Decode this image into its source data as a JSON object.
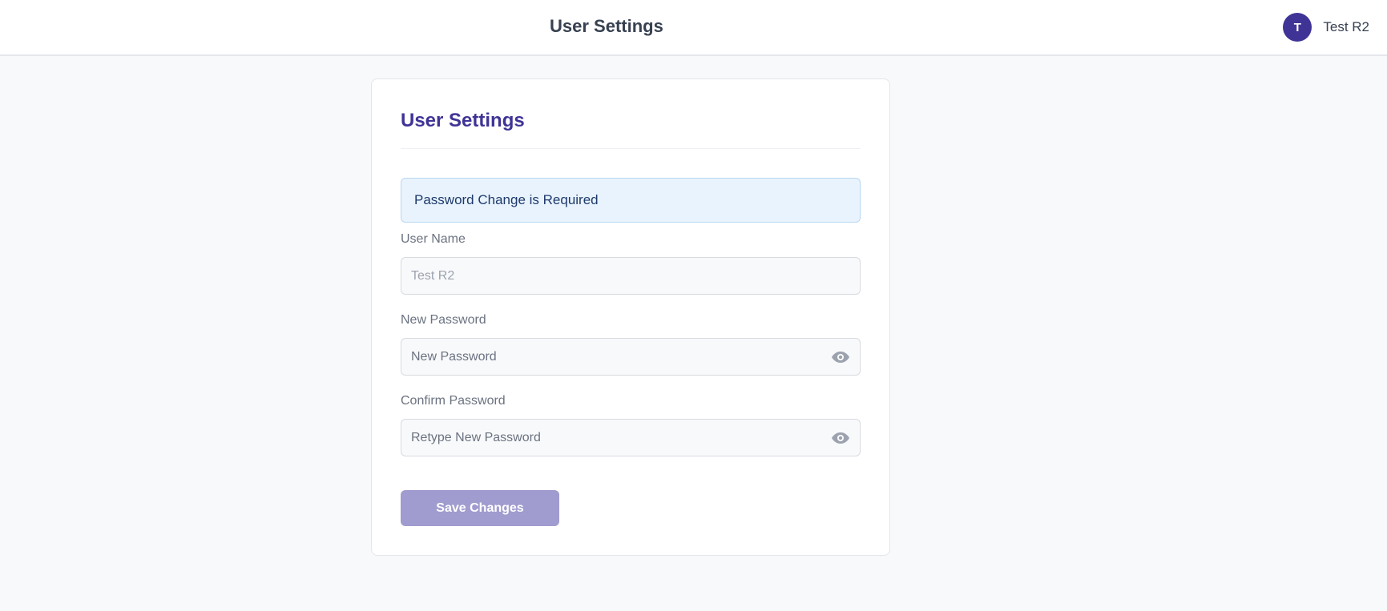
{
  "header": {
    "title": "User Settings",
    "avatar_initial": "T",
    "user_name": "Test R2"
  },
  "card": {
    "title": "User Settings",
    "alert_text": "Password Change is Required",
    "fields": {
      "user_name": {
        "label": "User Name",
        "value": "",
        "placeholder": "Test R2"
      },
      "new_password": {
        "label": "New Password",
        "value": "",
        "placeholder": "New Password",
        "icon": "eye-icon"
      },
      "confirm_password": {
        "label": "Confirm Password",
        "value": "",
        "placeholder": "Retype New Password",
        "icon": "eye-icon"
      }
    },
    "save_label": "Save Changes"
  },
  "colors": {
    "brand": "#3f3496",
    "button_disabled": "#a09ccf",
    "alert_bg": "#e8f3fd",
    "page_bg": "#f8f9fb"
  }
}
